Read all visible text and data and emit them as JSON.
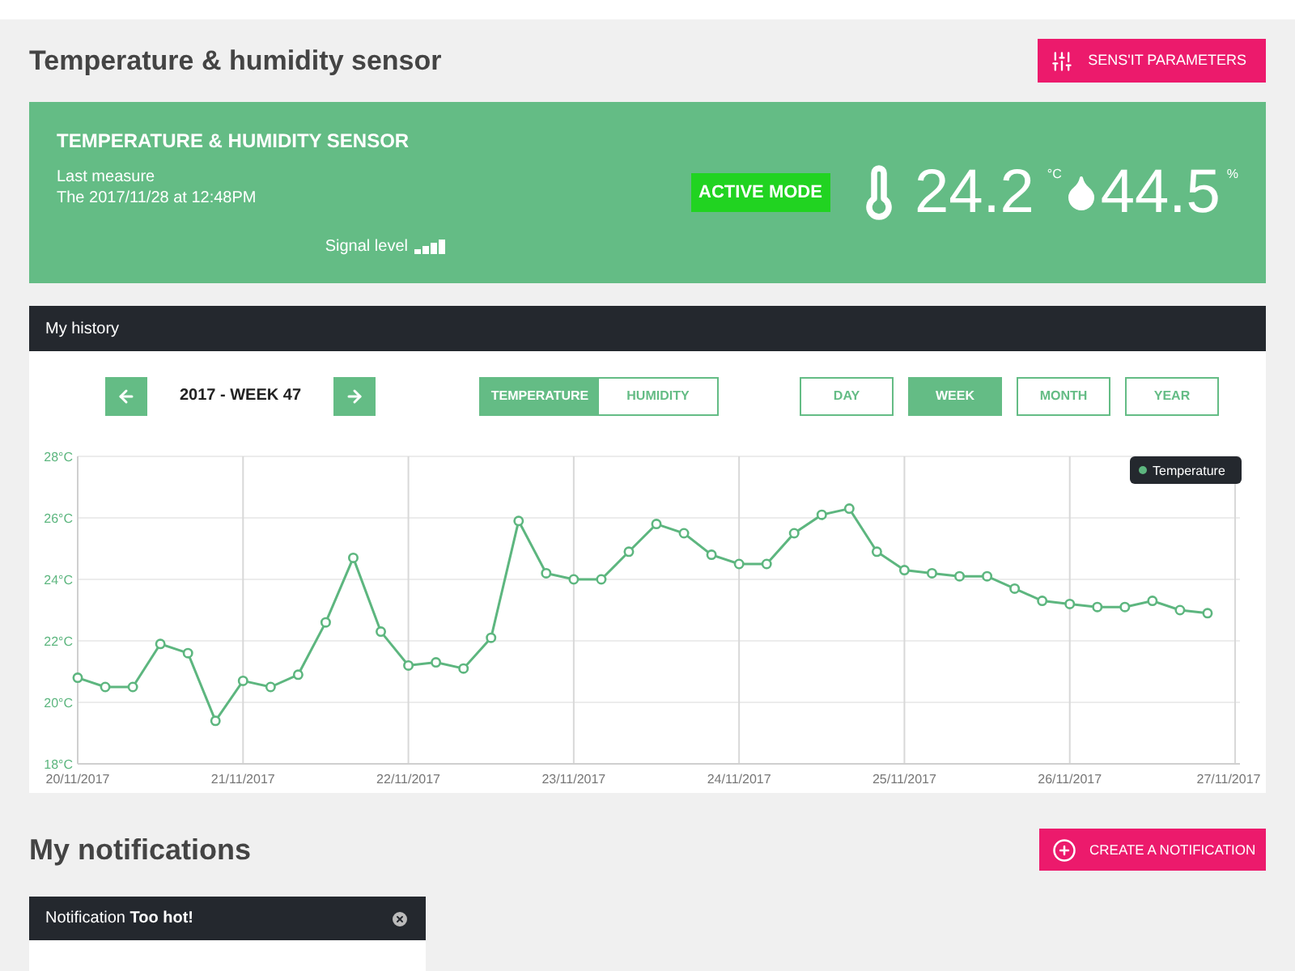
{
  "header": {
    "title": "Temperature & humidity sensor",
    "parameters_button": "SENS'IT PARAMETERS"
  },
  "sensor_card": {
    "title": "TEMPERATURE & HUMIDITY SENSOR",
    "last_measure_label": "Last measure",
    "last_measure_time": "The 2017/11/28 at 12:48PM",
    "signal_label": "Signal level",
    "mode_badge": "ACTIVE MODE",
    "temperature": "24.2",
    "temperature_unit": "°C",
    "humidity": "44.5",
    "humidity_unit": "%"
  },
  "history": {
    "title": "My history",
    "period_label": "2017 - WEEK 47",
    "metric_tabs": [
      {
        "label": "TEMPERATURE",
        "selected": true
      },
      {
        "label": "HUMIDITY",
        "selected": false
      }
    ],
    "range_tabs": [
      {
        "label": "DAY",
        "selected": false
      },
      {
        "label": "WEEK",
        "selected": true
      },
      {
        "label": "MONTH",
        "selected": false
      },
      {
        "label": "YEAR",
        "selected": false
      }
    ],
    "chart_data": {
      "type": "line",
      "categories": [
        "20/11/2017",
        null,
        null,
        null,
        null,
        null,
        "21/11/2017",
        null,
        null,
        null,
        null,
        null,
        "22/11/2017",
        null,
        null,
        null,
        null,
        null,
        "23/11/2017",
        null,
        null,
        null,
        null,
        null,
        "24/11/2017",
        null,
        null,
        null,
        null,
        null,
        "25/11/2017",
        null,
        null,
        null,
        null,
        null,
        "26/11/2017",
        null,
        null,
        null,
        null,
        null,
        "27/11/2017"
      ],
      "grid": true,
      "series": [
        {
          "name": "Temperature",
          "color": "#5db67f",
          "marker": "circle",
          "values": [
            20.8,
            20.5,
            20.5,
            21.9,
            21.6,
            19.4,
            20.7,
            20.5,
            20.9,
            22.6,
            24.7,
            22.3,
            21.2,
            21.3,
            21.1,
            22.1,
            25.9,
            24.2,
            24.0,
            24.0,
            24.9,
            25.8,
            25.5,
            24.8,
            24.5,
            24.5,
            25.5,
            26.1,
            26.3,
            24.9,
            24.3,
            24.2,
            24.1,
            24.1,
            23.7,
            23.3,
            23.2,
            23.1,
            23.1,
            23.3,
            23.0,
            22.9,
            null
          ]
        }
      ],
      "ylim": [
        18,
        28
      ],
      "yticks": [
        {
          "value": 18,
          "label": "18°C"
        },
        {
          "value": 20,
          "label": "20°C"
        },
        {
          "value": 22,
          "label": "22°C"
        },
        {
          "value": 24,
          "label": "24°C"
        },
        {
          "value": 26,
          "label": "26°C"
        },
        {
          "value": 28,
          "label": "28°C"
        }
      ]
    }
  },
  "notifications": {
    "title": "My notifications",
    "create_button": "CREATE A NOTIFICATION",
    "items": [
      {
        "text": "Notification **Too hot!**"
      }
    ]
  }
}
